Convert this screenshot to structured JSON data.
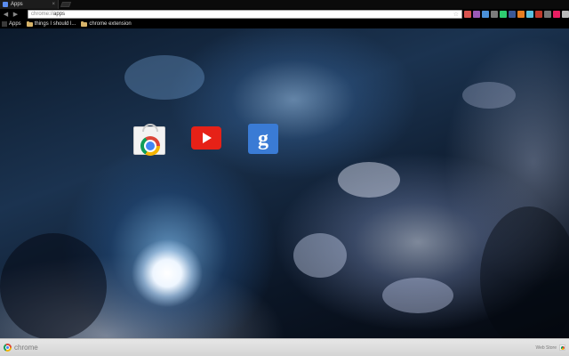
{
  "tab": {
    "title": "Apps",
    "close": "×"
  },
  "toolbar": {
    "back": "◀",
    "forward": "▶",
    "reload": "↻",
    "url_scheme": "chrome://",
    "url_path": "apps",
    "star": "☆",
    "extension_colors": [
      "#d9534f",
      "#9b59b6",
      "#4a90d9",
      "#7b7b7b",
      "#2ecc71",
      "#3b5998",
      "#e67e22",
      "#5bc0de",
      "#c0392b",
      "#777777",
      "#e91e63",
      "#bbbbbb"
    ]
  },
  "bookmarks": {
    "items": [
      {
        "label": "Apps",
        "icon": "apps-grid-icon"
      },
      {
        "label": "things I should l...",
        "icon": "folder-icon"
      },
      {
        "label": "chrome extension",
        "icon": "folder-icon"
      }
    ]
  },
  "apps": [
    {
      "name": "Web Store",
      "icon": "chrome-web-store-icon"
    },
    {
      "name": "YouTube",
      "icon": "youtube-icon"
    },
    {
      "name": "Google Search",
      "icon": "google-search-icon",
      "glyph": "g"
    }
  ],
  "footer": {
    "brand": "chrome",
    "webstore_label": "Web Store"
  },
  "colors": {
    "youtube_red": "#e62117",
    "google_blue": "#3a7bd5",
    "bookmark_folder": "#d7b46a"
  }
}
